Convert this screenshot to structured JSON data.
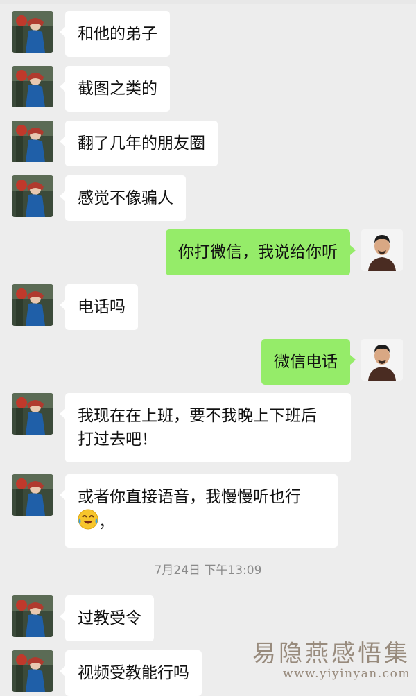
{
  "messages": [
    {
      "side": "left",
      "text": "和他的弟子"
    },
    {
      "side": "left",
      "text": "截图之类的"
    },
    {
      "side": "left",
      "text": "翻了几年的朋友圈"
    },
    {
      "side": "left",
      "text": "感觉不像骗人"
    },
    {
      "side": "right",
      "text": "你打微信，我说给你听"
    },
    {
      "side": "left",
      "text": "电话吗"
    },
    {
      "side": "right",
      "text": "微信电话"
    },
    {
      "side": "left",
      "line1": "我现在在上班，要不我晚上下班后",
      "line2": "打过去吧！"
    },
    {
      "side": "left",
      "line1": "或者你直接语音，我慢慢听也行",
      "line2_suffix": "，",
      "emoji": "face-with-tears-of-joy-icon"
    },
    {
      "side": "left",
      "text": "过教受令"
    },
    {
      "side": "left",
      "text": "视频受教能行吗"
    }
  ],
  "timestamp": "7月24日 下午13:09",
  "watermark": {
    "title": "易隐燕感悟集",
    "url": "www.yiyinyan.com"
  },
  "colors": {
    "background": "#ededed",
    "incoming_bubble": "#ffffff",
    "outgoing_bubble": "#95ec69"
  }
}
